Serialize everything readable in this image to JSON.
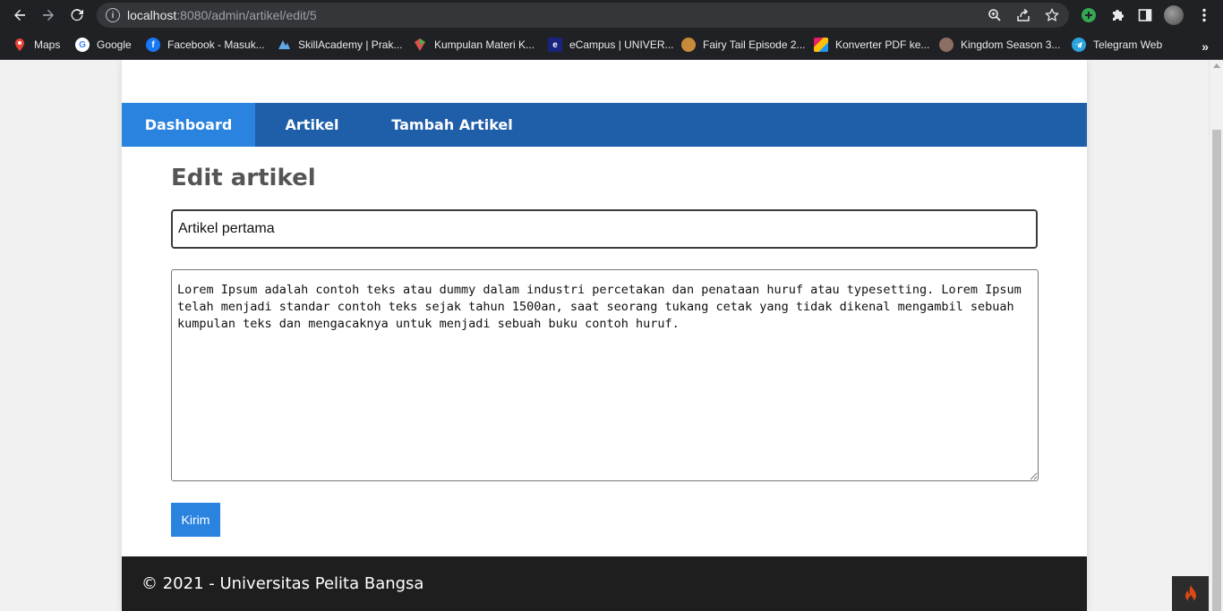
{
  "browser": {
    "url_host": "localhost",
    "url_rest": ":8080/admin/artikel/edit/5",
    "bookmarks": [
      {
        "label": "Maps",
        "icon": "maps-icon",
        "color": "#34a853"
      },
      {
        "label": "Google",
        "icon": "google-icon",
        "color": "#ffffff"
      },
      {
        "label": "Facebook - Masuk...",
        "icon": "facebook-icon",
        "color": "#1877f2"
      },
      {
        "label": "SkillAcademy | Prak...",
        "icon": "skillacademy-icon",
        "color": "#5fa8e8"
      },
      {
        "label": "Kumpulan Materi K...",
        "icon": "materi-icon",
        "color": "#d9534f"
      },
      {
        "label": "eCampus | UNIVER...",
        "icon": "ecampus-icon",
        "color": "#1a237e"
      },
      {
        "label": "Fairy Tail Episode 2...",
        "icon": "fairytail-icon",
        "color": "#c78a3a"
      },
      {
        "label": "Konverter PDF ke...",
        "icon": "pdf-converter-icon",
        "color": "#e91e63"
      },
      {
        "label": "Kingdom Season 3...",
        "icon": "kingdom-icon",
        "color": "#8d6e63"
      },
      {
        "label": "Telegram Web",
        "icon": "telegram-icon",
        "color": "#2aa3df"
      }
    ],
    "more": "»"
  },
  "nav": {
    "items": [
      {
        "label": "Dashboard",
        "active": true
      },
      {
        "label": "Artikel",
        "active": false
      },
      {
        "label": "Tambah Artikel",
        "active": false
      }
    ]
  },
  "form": {
    "heading": "Edit artikel",
    "title_value": "Artikel pertama",
    "body_value": "Lorem Ipsum adalah contoh teks atau dummy dalam industri percetakan dan penataan huruf atau typesetting. Lorem Ipsum telah menjadi standar contoh teks sejak tahun 1500an, saat seorang tukang cetak yang tidak dikenal mengambil sebuah kumpulan teks dan mengacaknya untuk menjadi sebuah buku contoh huruf.",
    "submit_label": "Kirim"
  },
  "footer": {
    "text": "© 2021 - Universitas Pelita Bangsa"
  },
  "colors": {
    "nav_bg": "#1f5faa",
    "nav_active": "#2b83e0",
    "button": "#2b83e0",
    "footer_bg": "#1e1e1e"
  }
}
